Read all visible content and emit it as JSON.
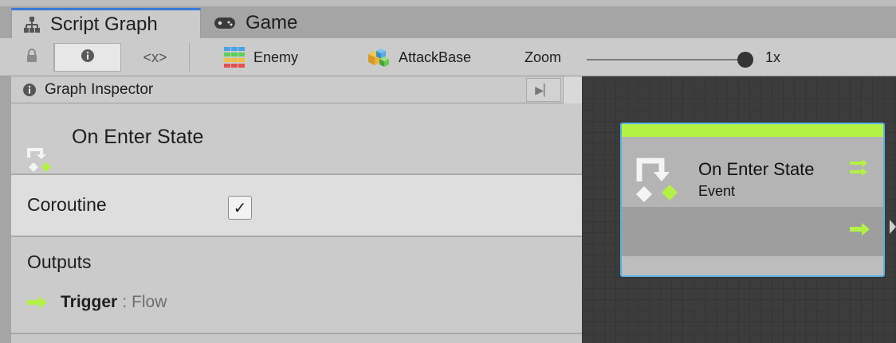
{
  "tabs": [
    {
      "label": "Script Graph",
      "icon": "graph-hierarchy-icon",
      "active": true
    },
    {
      "label": "Game",
      "icon": "gamepad-icon",
      "active": false
    }
  ],
  "toolbar": {
    "vars_label": "<x>",
    "items": [
      {
        "label": "Enemy",
        "icon": "grid-blocks-icon"
      },
      {
        "label": "AttackBase",
        "icon": "cubes-icon"
      }
    ],
    "zoom_label": "Zoom",
    "zoom_value": "1x",
    "zoom_level": 0.95
  },
  "inspector": {
    "header": "Graph Inspector",
    "title": "On Enter State",
    "coroutine_label": "Coroutine",
    "coroutine_checked": true,
    "outputs_heading": "Outputs",
    "output_port": {
      "name": "Trigger",
      "separator": ":",
      "type": "Flow"
    }
  },
  "node": {
    "title": "On Enter State",
    "subtitle": "Event"
  },
  "colors": {
    "flow_accent": "#b3f244",
    "node_border": "#58b2e6",
    "tab_active_bar": "#3a79d6"
  }
}
